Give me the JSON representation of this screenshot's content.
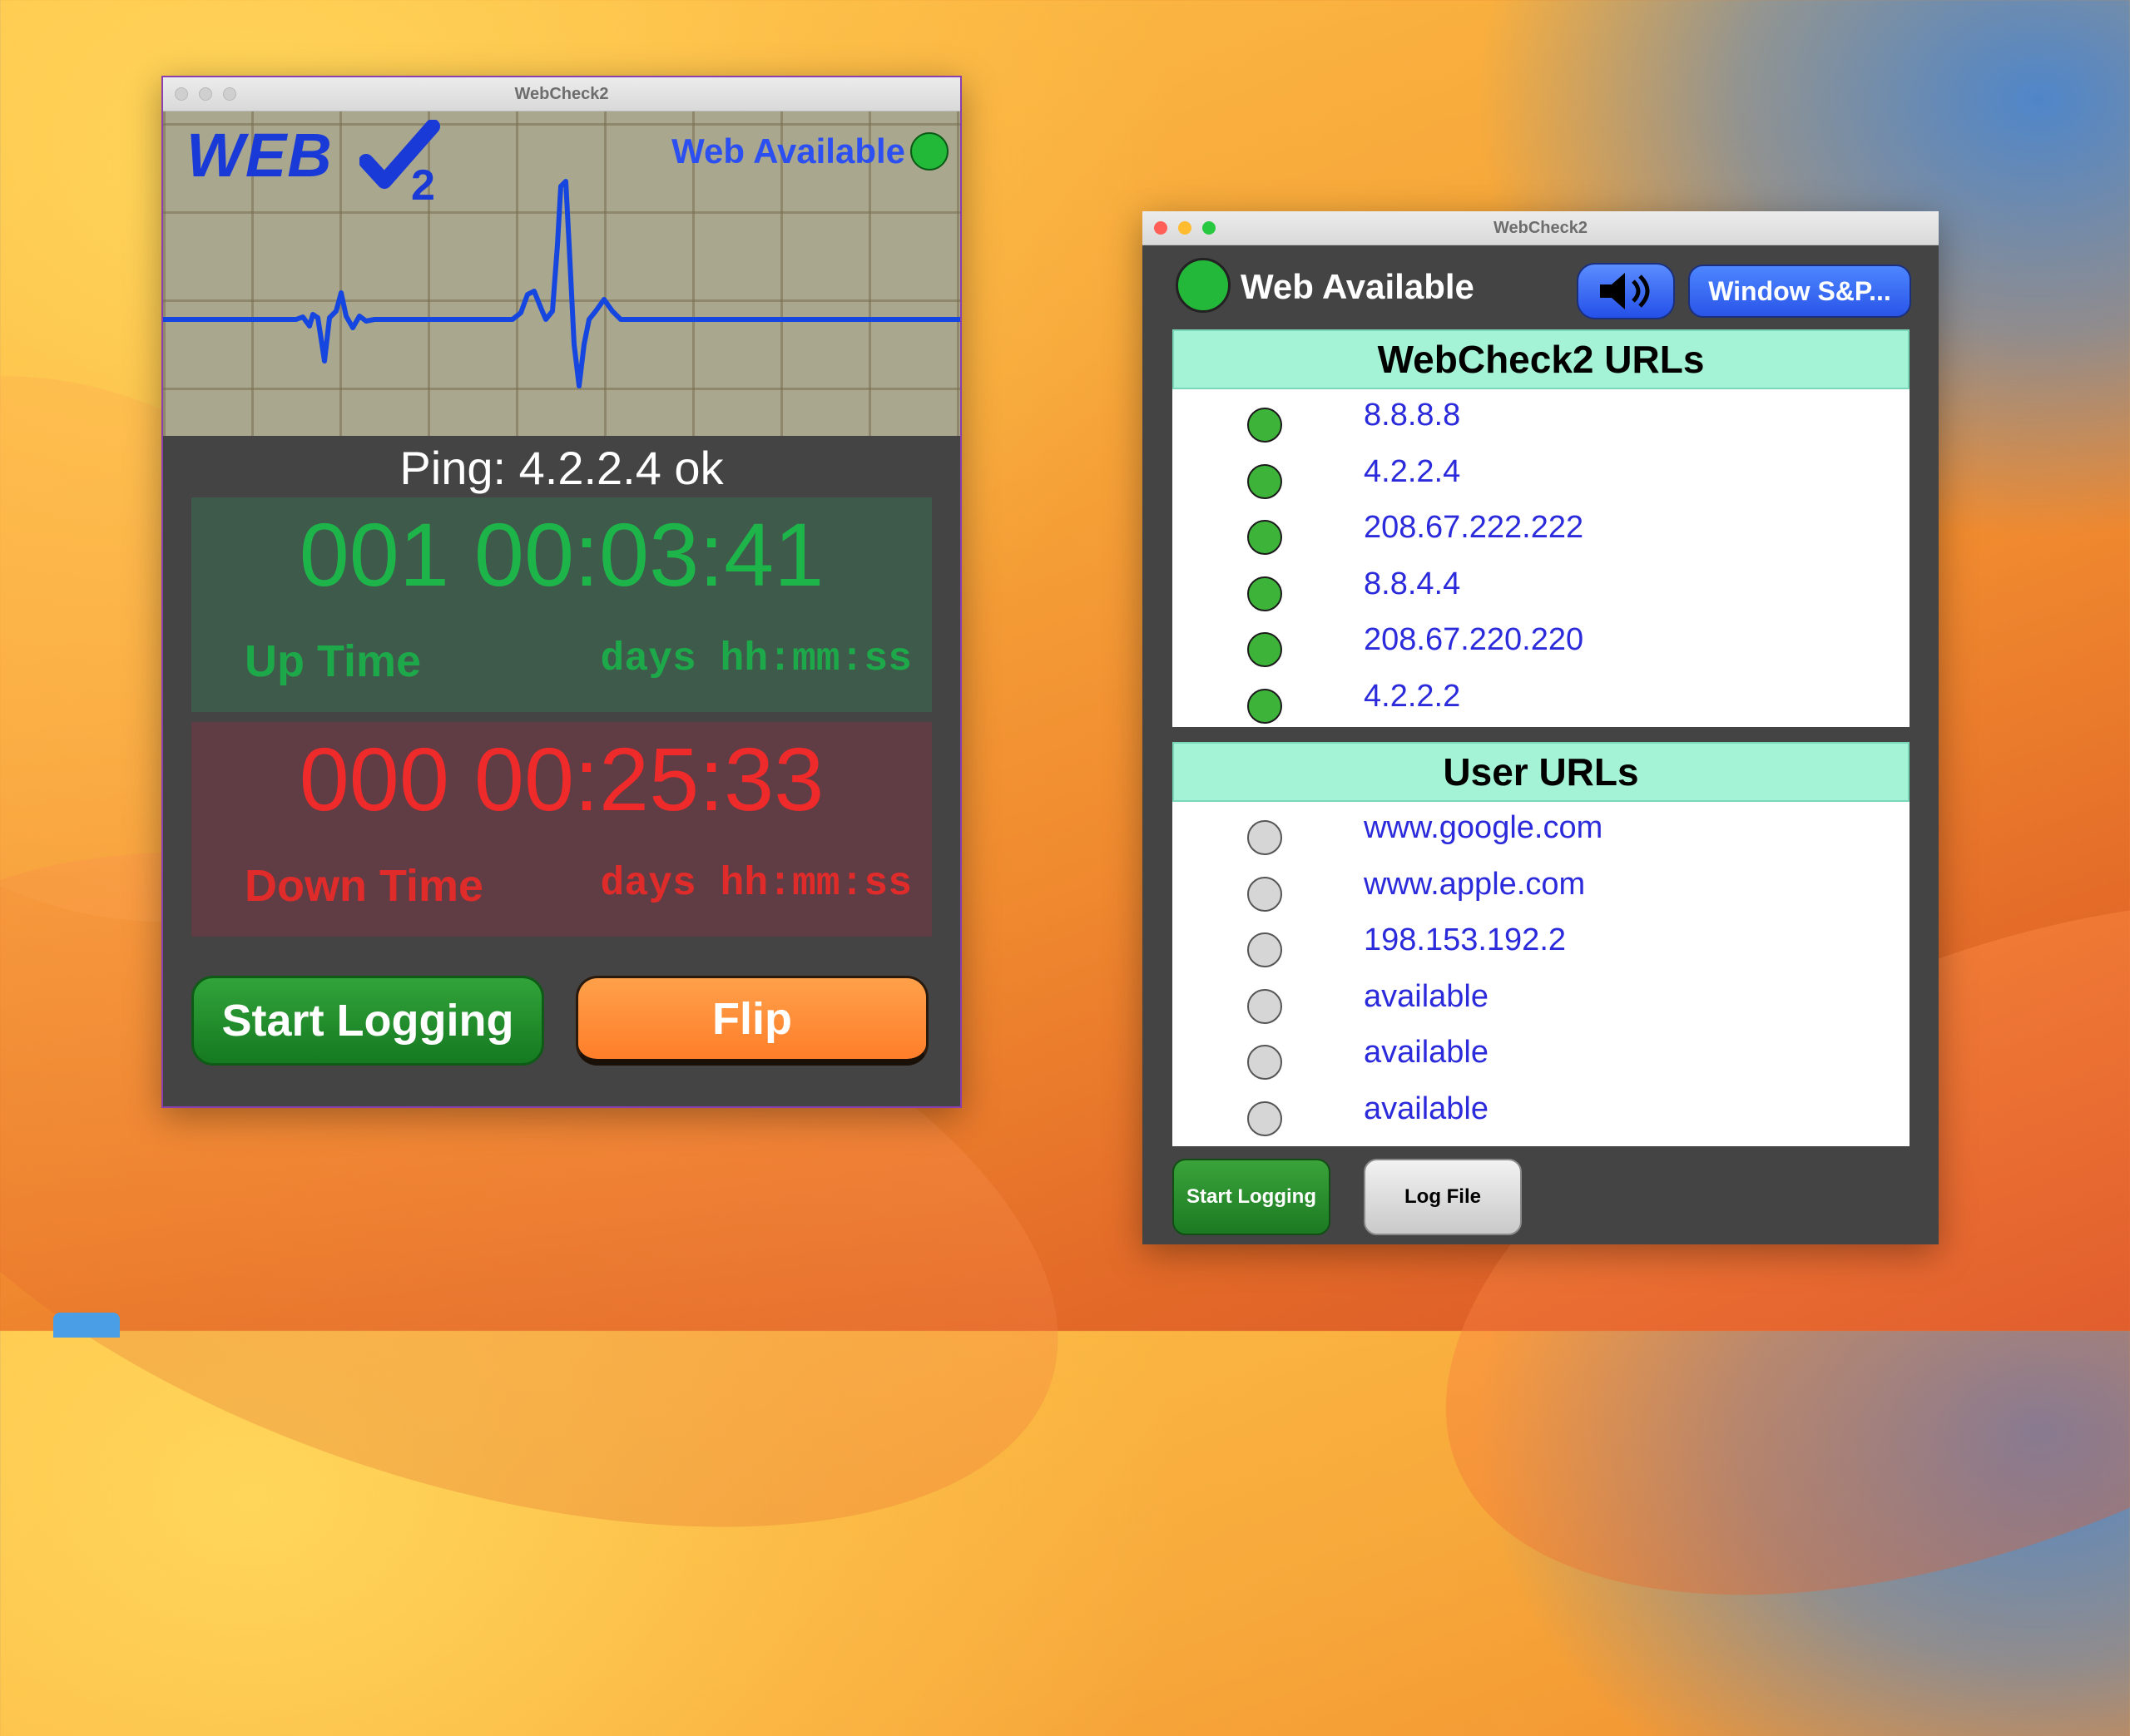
{
  "desktop": {
    "folder_icon": "folder-icon"
  },
  "window_main": {
    "title": "WebCheck2",
    "logo_text": "WEB",
    "logo_sub": "2",
    "web_status": "Web Available",
    "ping_text": "Ping: 4.2.2.4 ok",
    "uptime": {
      "value": "001 00:03:41",
      "label": "Up Time",
      "format": "days hh:mm:ss"
    },
    "downtime": {
      "value": "000 00:25:33",
      "label": "Down Time",
      "format": "days hh:mm:ss"
    },
    "buttons": {
      "start_logging": "Start Logging",
      "flip": "Flip"
    }
  },
  "window_urls": {
    "title": "WebCheck2",
    "web_status": "Web Available",
    "window_button": "Window S&P...",
    "speaker_icon": "speaker-icon",
    "webcheck_urls": {
      "header": "WebCheck2 URLs",
      "items": [
        {
          "url": "8.8.8.8",
          "status": "up"
        },
        {
          "url": "4.2.2.4",
          "status": "up"
        },
        {
          "url": "208.67.222.222",
          "status": "up"
        },
        {
          "url": "8.8.4.4",
          "status": "up"
        },
        {
          "url": "208.67.220.220",
          "status": "up"
        },
        {
          "url": "4.2.2.2",
          "status": "up"
        }
      ]
    },
    "user_urls": {
      "header": "User URLs",
      "items": [
        {
          "url": "www.google.com",
          "status": "unknown"
        },
        {
          "url": "www.apple.com",
          "status": "unknown"
        },
        {
          "url": "198.153.192.2",
          "status": "unknown"
        },
        {
          "url": "available",
          "status": "unknown"
        },
        {
          "url": "available",
          "status": "unknown"
        },
        {
          "url": "available",
          "status": "unknown"
        }
      ]
    },
    "buttons": {
      "start_logging": "Start Logging",
      "log_file": "Log File"
    }
  },
  "colors": {
    "status_up": "#3db33a",
    "status_unknown": "#d6d6d6",
    "url_text": "#2b2bdc",
    "panel_header": "#a5f3d7",
    "uptime_text": "#1db44a",
    "downtime_text": "#ee2a2a"
  }
}
